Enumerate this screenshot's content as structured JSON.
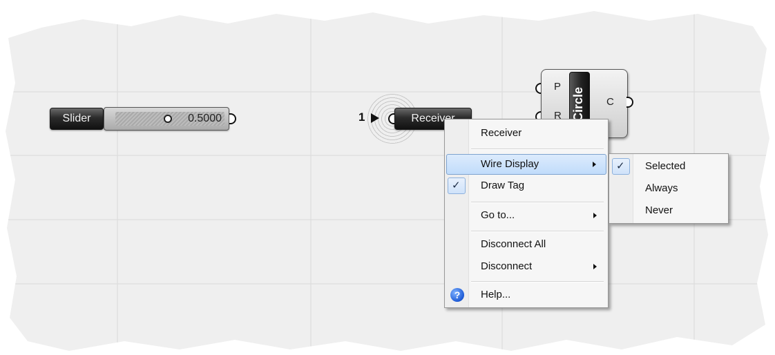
{
  "slider": {
    "label": "Slider",
    "value": "0.5000"
  },
  "receiver": {
    "label": "Receiver",
    "tag_number": "1"
  },
  "circle_component": {
    "name": "Circle",
    "inputs": [
      "P",
      "R"
    ],
    "output": "C"
  },
  "context_menu": {
    "header": "Receiver",
    "items": [
      {
        "label": "Wire Display",
        "submenu": true,
        "highlighted": true
      },
      {
        "label": "Draw Tag",
        "checked": true
      },
      {
        "label": "Go to...",
        "submenu": true
      },
      {
        "label": "Disconnect All"
      },
      {
        "label": "Disconnect",
        "submenu": true
      },
      {
        "label": "Help...",
        "icon": "help-icon"
      }
    ]
  },
  "wire_display_submenu": {
    "items": [
      {
        "label": "Selected",
        "checked": true
      },
      {
        "label": "Always"
      },
      {
        "label": "Never"
      }
    ]
  },
  "colors": {
    "menu_highlight": "#c1dcfb",
    "component_dark": "#2b2b2b",
    "canvas_bg": "#f0f0f0"
  }
}
